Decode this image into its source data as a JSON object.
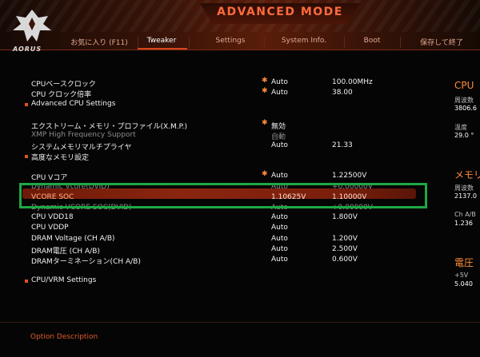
{
  "header": {
    "title": "ADVANCED MODE",
    "brand": "AORUS"
  },
  "tabs": [
    {
      "label": "お気に入り (F11)",
      "active": false
    },
    {
      "label": "Tweaker",
      "active": true
    },
    {
      "label": "Settings",
      "active": false
    },
    {
      "label": "System Info.",
      "active": false
    },
    {
      "label": "Boot",
      "active": false
    },
    {
      "label": "保存して終了",
      "active": false
    }
  ],
  "settings": [
    {
      "label": "CPUベースクロック",
      "star": true,
      "value1": "Auto",
      "value2": "100.00MHz"
    },
    {
      "label": "CPU クロック倍率",
      "star": true,
      "value1": "Auto",
      "value2": "38.00"
    },
    {
      "label": "Advanced CPU Settings",
      "bullet": true
    },
    {
      "label": "エクストリーム・メモリ・プロファイル(X.M.P.)",
      "star": true,
      "value1": "無効",
      "value2": ""
    },
    {
      "label": "XMP High Frequency Support",
      "dim": true,
      "value1": "自動",
      "value2": ""
    },
    {
      "label": "システムメモリマルチプライヤ",
      "value1": "Auto",
      "value2": "21.33"
    },
    {
      "label": "高度なメモリ設定",
      "bullet": true
    },
    {
      "label": "CPU Vコア",
      "star": true,
      "value1": "Auto",
      "value2": "1.22500V"
    },
    {
      "label": "Dynamic Vcore(DVID)",
      "dim": true,
      "value1": "Auto",
      "value2": "+0.00000V"
    },
    {
      "label": "VCORE SOC",
      "highlight": true,
      "value1": "1.10625V",
      "value2": "1.10000V"
    },
    {
      "label": "Dynamic VCORE SOC(DVID)",
      "dim": true,
      "value1": "Auto",
      "value2": "+0.00000V"
    },
    {
      "label": "CPU VDD18",
      "value1": "Auto",
      "value2": "1.800V"
    },
    {
      "label": "CPU VDDP",
      "value1": "Auto",
      "value2": ""
    },
    {
      "label": "DRAM Voltage     (CH A/B)",
      "value1": "Auto",
      "value2": "1.200V"
    },
    {
      "label": "DRAM電圧          (CH A/B)",
      "value1": "Auto",
      "value2": "2.500V"
    },
    {
      "label": "DRAMターミネーション(CH A/B)",
      "value1": "Auto",
      "value2": "0.600V"
    },
    {
      "label": "CPU/VRM Settings",
      "bullet": true
    }
  ],
  "footer": {
    "option_description": "Option Description"
  },
  "right_panel": {
    "cpu_title": "CPU",
    "freq_label": "周波数",
    "freq_value": "3806.6",
    "temp_label": "温度",
    "temp_value": "29.0 °",
    "mem_title": "メモリ",
    "mem_freq_label": "周波数",
    "mem_freq_value": "2137.0",
    "mem_volt_label": "Ch A/B",
    "mem_volt_value": "1.236",
    "volt_title": "電圧",
    "v5_label": "+5V",
    "v5_value": "5.040"
  },
  "colors": {
    "accent": "#e0541f",
    "highlight_bar": "#8a2510",
    "selection_box": "#1ea843"
  }
}
